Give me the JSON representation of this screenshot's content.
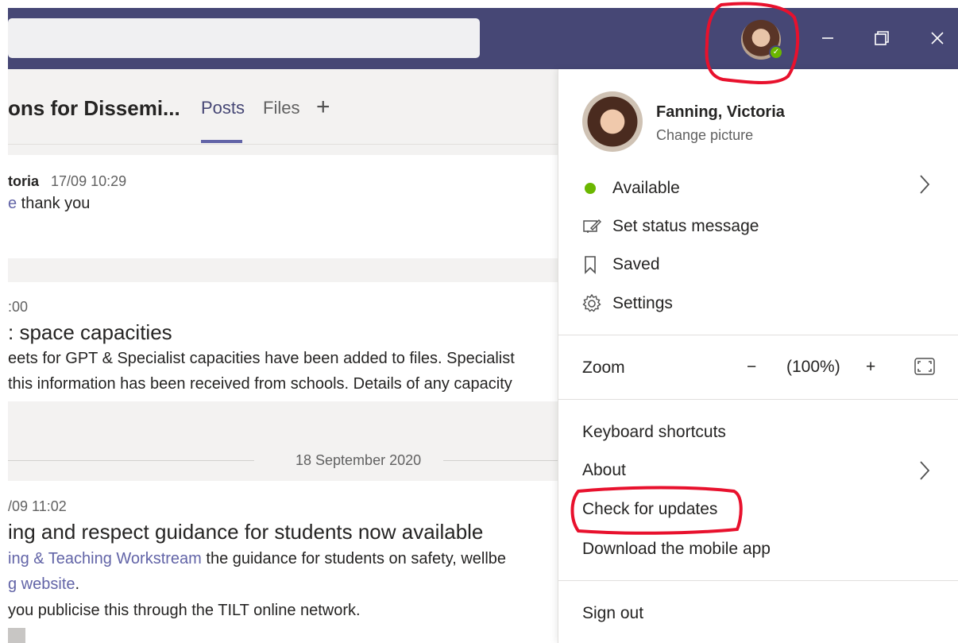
{
  "titlebar": {
    "search_placeholder": "",
    "window_controls": [
      "minimize-icon",
      "restore-icon",
      "close-icon"
    ],
    "accent": "#464775"
  },
  "channel": {
    "title": "ons for Dissemi...",
    "tabs": [
      {
        "label": "Posts",
        "active": true
      },
      {
        "label": "Files",
        "active": false
      }
    ],
    "add_tab_glyph": "+"
  },
  "posts": [
    {
      "author": "toria",
      "time": "17/09 10:29",
      "link_fragment": "e",
      "text": " thank you"
    },
    {
      "time": ":00",
      "title": ": space capacities",
      "lines": [
        "eets for GPT & Specialist capacities have been added to files.  Specialist",
        "this information has been received from schools.  Details of any capacity"
      ]
    },
    {
      "time": "/09 11:02",
      "title": "ing and respect guidance for students now available",
      "line1_link": "ing & Teaching Workstream",
      "line1_text": " the guidance for students on safety, wellbe",
      "line2_link": "g website",
      "line2_text": ".",
      "line3": " you publicise this through the TILT online network."
    }
  ],
  "date_divider": "18 September 2020",
  "profile_menu": {
    "name": "Fanning, Victoria",
    "change_picture": "Change picture",
    "status": "Available",
    "set_status": "Set status message",
    "saved": "Saved",
    "settings": "Settings",
    "zoom_label": "Zoom",
    "zoom_minus": "−",
    "zoom_value": "(100%)",
    "zoom_plus": "+",
    "keyboard_shortcuts": "Keyboard shortcuts",
    "about": "About",
    "check_updates": "Check for updates",
    "download_app": "Download the mobile app",
    "sign_out": "Sign out"
  },
  "colors": {
    "status_green": "#6bb700",
    "link": "#6264a7",
    "annotation_red": "#e8112d"
  }
}
